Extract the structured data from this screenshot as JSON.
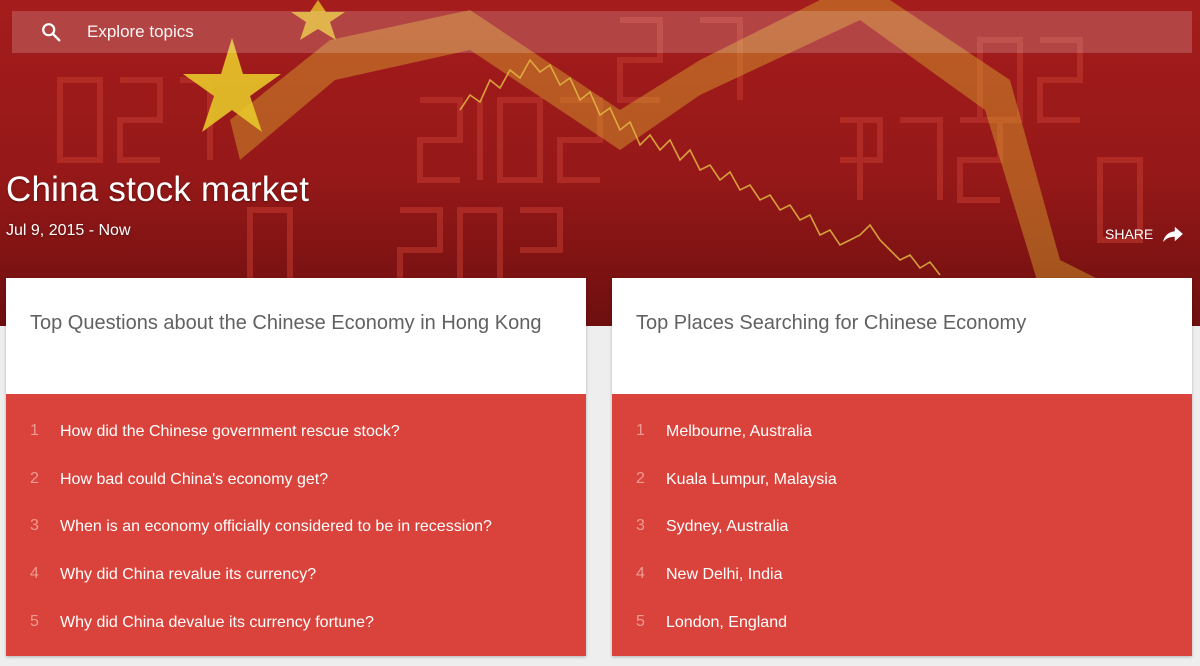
{
  "search": {
    "placeholder": "Explore topics"
  },
  "hero": {
    "title": "China stock market",
    "date_range": "Jul 9, 2015 - Now",
    "share_label": "SHARE"
  },
  "cards": [
    {
      "title": "Top Questions about the Chinese Economy in Hong Kong",
      "items": [
        {
          "rank": "1",
          "text": "How did the Chinese government rescue stock?"
        },
        {
          "rank": "2",
          "text": "How bad could China's economy get?"
        },
        {
          "rank": "3",
          "text": "When is an economy officially considered to be in recession?"
        },
        {
          "rank": "4",
          "text": "Why did China revalue its currency?"
        },
        {
          "rank": "5",
          "text": "Why did China devalue its currency fortune?"
        }
      ]
    },
    {
      "title": "Top Places Searching for Chinese Economy",
      "items": [
        {
          "rank": "1",
          "text": "Melbourne, Australia"
        },
        {
          "rank": "2",
          "text": "Kuala Lumpur, Malaysia"
        },
        {
          "rank": "3",
          "text": "Sydney, Australia"
        },
        {
          "rank": "4",
          "text": "New Delhi, India"
        },
        {
          "rank": "5",
          "text": "London, England"
        }
      ]
    }
  ],
  "colors": {
    "hero_red": "#a51c1c",
    "card_red": "#d9433b",
    "rank_text": "#f09a92",
    "star_yellow": "#e7c62a"
  },
  "icons": {
    "search": "search-icon",
    "share": "share-icon"
  }
}
